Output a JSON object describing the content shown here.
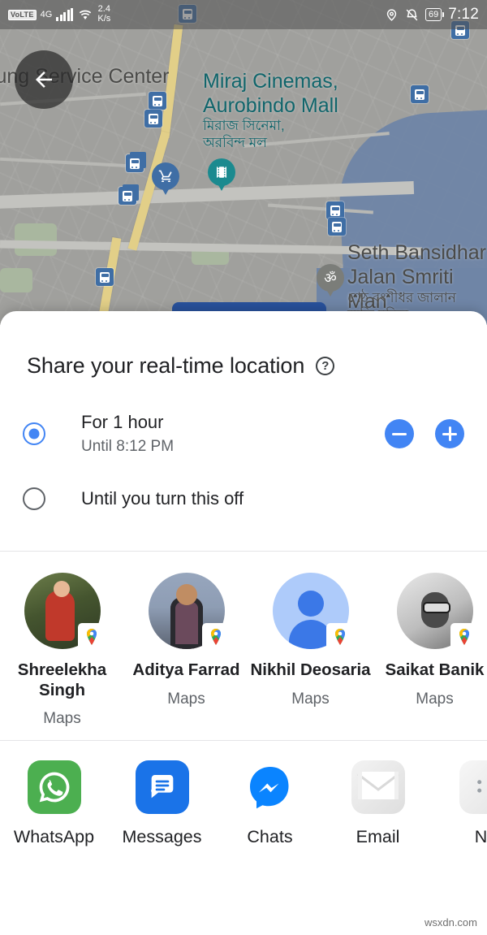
{
  "status_bar": {
    "volte": "VoLTE",
    "network": "4G",
    "signal_icon": "signal-bars-icon",
    "wifi_icon": "wifi-icon",
    "data_speed": "2.4",
    "data_speed_unit": "K/s",
    "location_icon": "location-pin-icon",
    "mute_icon": "bell-off-icon",
    "battery_level": "69",
    "time": "7:12"
  },
  "map": {
    "back_icon": "back-arrow-icon",
    "labels": [
      {
        "text": "sung Service Center",
        "kind": "poi"
      },
      {
        "text": "Miraj Cinemas,",
        "kind": "poi-teal"
      },
      {
        "text": "Aurobindo Mall",
        "kind": "poi-teal"
      },
      {
        "text": "মিরাজ সিনেমা,",
        "kind": "poi-teal-bn"
      },
      {
        "text": "অরবিন্দ মল",
        "kind": "poi-teal-bn"
      },
      {
        "text": "Seth Bansidhar",
        "kind": "poi"
      },
      {
        "text": "Jalan Smriti Man",
        "kind": "poi"
      },
      {
        "text": "শেঠ বংশীধর জালান",
        "kind": "poi-bn"
      },
      {
        "text": "স্মৃতি মন্দির",
        "kind": "poi-bn"
      }
    ],
    "pins": [
      {
        "icon": "shopping-cart-pin-icon"
      },
      {
        "icon": "cinema-pin-icon"
      },
      {
        "icon": "temple-om-pin-icon"
      }
    ],
    "transit_icon": "bus-stop-icon"
  },
  "sheet": {
    "title": "Share your real-time location",
    "help_icon": "help-circle-icon",
    "options": [
      {
        "label": "For 1 hour",
        "sublabel": "Until 8:12 PM",
        "selected": true
      },
      {
        "label": "Until you turn this off",
        "sublabel": "",
        "selected": false
      }
    ],
    "decrease_button_label": "−",
    "decrease_icon": "minus-icon",
    "increase_button_label": "+",
    "increase_icon": "plus-icon",
    "accent_color": "#4285F4"
  },
  "contacts": [
    {
      "name": "Shreelekha Singh",
      "app": "Maps",
      "badge_icon": "google-maps-pin-icon",
      "avatar": "photo"
    },
    {
      "name": "Aditya Farrad",
      "app": "Maps",
      "badge_icon": "google-maps-pin-icon",
      "avatar": "photo"
    },
    {
      "name": "Nikhil Deosaria",
      "app": "Maps",
      "badge_icon": "google-maps-pin-icon",
      "avatar": "default-person"
    },
    {
      "name": "Saikat Banik",
      "app": "Maps",
      "badge_icon": "google-maps-pin-icon",
      "avatar": "photo"
    }
  ],
  "apps": [
    {
      "name": "WhatsApp",
      "icon": "whatsapp-icon",
      "color": "#4CAF50"
    },
    {
      "name": "Messages",
      "icon": "google-messages-icon",
      "color": "#1A73E8"
    },
    {
      "name": "Chats",
      "icon": "messenger-icon",
      "color": "#0099FF"
    },
    {
      "name": "Email",
      "icon": "email-envelope-icon",
      "color": "#E8E8E8"
    },
    {
      "name": "No",
      "icon": "notes-icon",
      "color": "#EFEFEF"
    }
  ],
  "watermark": "wsxdn.com"
}
